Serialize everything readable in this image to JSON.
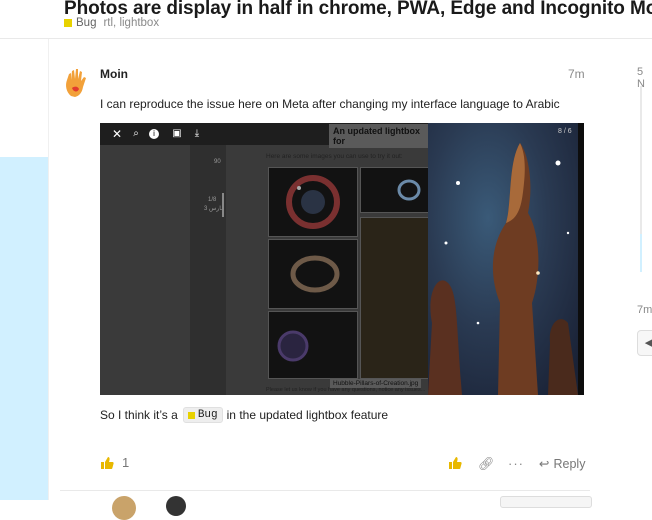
{
  "topic": {
    "title": "Photos are display in half in chrome, PWA, Edge and Incognito Mode",
    "category": "Bug",
    "category_color": "#e8d200",
    "tags": "rtl, lightbox"
  },
  "timeline": {
    "top_date": "5 N",
    "bottom_date": "7m"
  },
  "post": {
    "username": "Moin",
    "time": "7m",
    "text1": "I can reproduce the issue here on Meta after changing my interface language to Arabic",
    "text2_before": "So I think it’s a",
    "badge_label": "Bug",
    "text2_after": "in the updated lightbox feature",
    "likes": "1",
    "reply_label": "Reply"
  },
  "screenshot": {
    "heading": "An updated lightbox for",
    "intro": "Here are some images you can use to try it out:",
    "counter": "8 / 6",
    "caption": "Hubble-Pillars-of-Creation.jpg",
    "footer": "Please let us know if you have any questions, notice any issues...",
    "sidebar_a": "90",
    "sidebar_b": "1/8",
    "sidebar_c": "3 مارس"
  }
}
